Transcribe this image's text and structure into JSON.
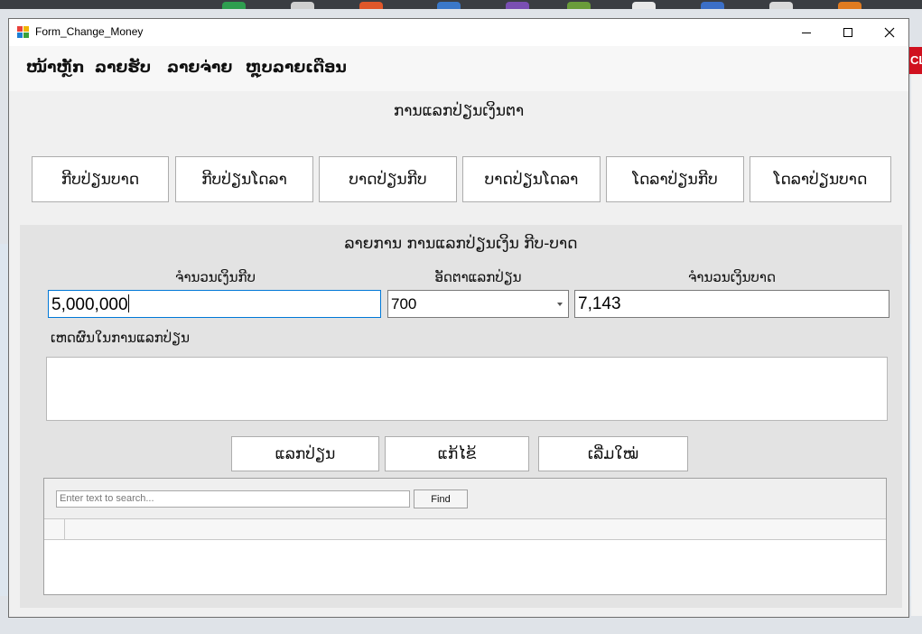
{
  "window": {
    "title": "Form_Change_Money"
  },
  "menu": [
    "ໜ້າຫຼັກ",
    "ລາຍຮັບ",
    "ລາຍຈ່າຍ",
    "ຫຼຸບລາຍເດືອນ"
  ],
  "heading": "ການແລກປ່ຽນເງິນຕາ",
  "conversion_buttons": [
    "ກີບປ່ຽນບາດ",
    "ກີບປ່ຽນໂດລາ",
    "ບາດປ່ຽນກີບ",
    "ບາດປ່ຽນໂດລາ",
    "ໂດລາປ່ຽນກີບ",
    "ໂດລາປ່ຽນບາດ"
  ],
  "form": {
    "title": "ລາຍການ ການແລກປ່ຽນເງິນ ກີບ-ບາດ",
    "kip_label": "ຈຳນວນເງິນກີບ",
    "kip_value": "5,000,000",
    "rate_label": "ອັດຕາແລກປ່ຽນ",
    "rate_value": "700",
    "baht_label": "ຈຳນວນເງິນບາດ",
    "baht_value": "7,143",
    "reason_label": "ເຫດຜົນໃນການແລກປ່ຽນ",
    "reason_value": ""
  },
  "actions": [
    "ແລກປ່ຽນ",
    "ແກ້ໄຂ້",
    "ເລີ່ມໃໝ່"
  ],
  "grid": {
    "search_placeholder": "Enter text to search...",
    "find_label": "Find"
  },
  "side_tab": "CL",
  "colors": {
    "focus_border": "#0078d7",
    "side_tab": "#d0101e"
  }
}
